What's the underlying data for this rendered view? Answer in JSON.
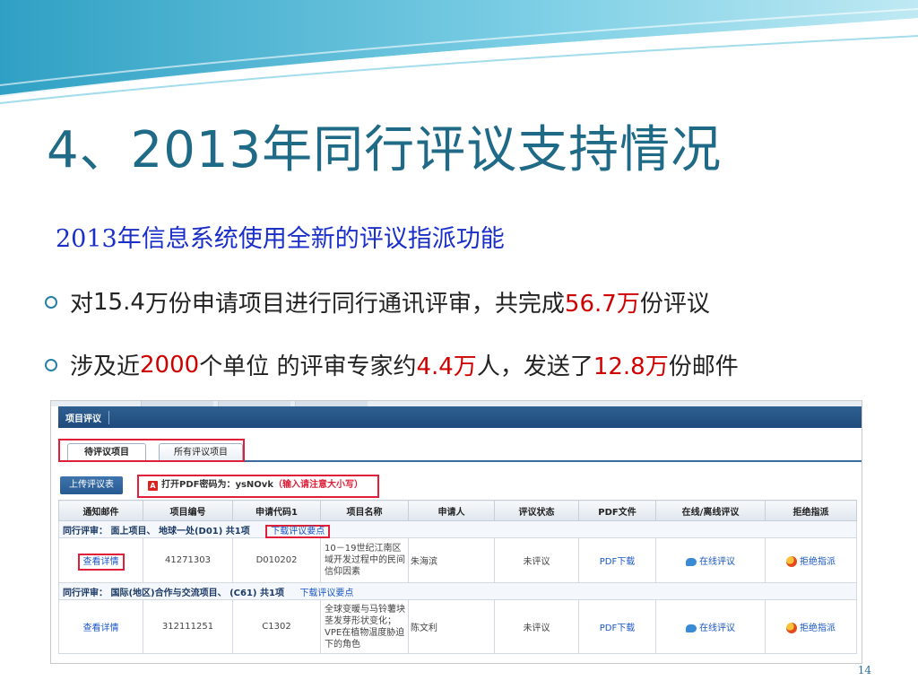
{
  "slide": {
    "title": "4、2013年同行评议支持情况",
    "subtitle": "2013年信息系统使用全新的评议指派功能",
    "bullet1": {
      "a": "对",
      "b": "15.4",
      "c": "万份申请项目进行同行通讯评审，共完成",
      "d": "56.7万",
      "e": "份评议"
    },
    "bullet2": {
      "a": "涉及近",
      "b": "2000",
      "c": "个单位 的评审专家约",
      "d": "4.4万",
      "e": "人，发送了",
      "f": "12.8万",
      "g": "份邮件"
    },
    "page_number": "14",
    "accent_color": "#1f6a86",
    "highlight_color": "#d00000"
  },
  "screenshot": {
    "nav_tab": "项目评议",
    "tabs": [
      "待评议项目",
      "所有评议项目"
    ],
    "upload_button": "上传评议表",
    "pdf_password_label": "打开PDF密码为：ysNOvk",
    "pdf_password_warning": "（输入请注意大小写）",
    "columns": [
      "通知邮件",
      "项目编号",
      "申请代码1",
      "项目名称",
      "申请人",
      "评议状态",
      "PDF文件",
      "在线/离线评议",
      "拒绝指派"
    ],
    "groups": [
      {
        "label": "同行评审： 面上项目、 地球一处(D01) 共1项",
        "download": "下载评议要点"
      },
      {
        "label": "同行评审： 国际(地区)合作与交流项目、 (C61) 共1项",
        "download": "下载评议要点"
      }
    ],
    "rows": [
      {
        "detail": "查看详情",
        "project_no": "41271303",
        "code": "D010202",
        "name": "10－19世纪江南区域开发过程中的民间信仰因素",
        "applicant": "朱海滨",
        "status": "未评议",
        "pdf": "PDF下载",
        "online": "在线评议",
        "refuse": "拒绝指派"
      },
      {
        "detail": "查看详情",
        "project_no": "312111251",
        "code": "C1302",
        "name": "全球变暖与马铃薯块茎发芽形状变化；VPE在植物温度胁迫下的角色",
        "applicant": "陈文利",
        "status": "未评议",
        "pdf": "PDF下载",
        "online": "在线评议",
        "refuse": "拒绝指派"
      }
    ]
  }
}
